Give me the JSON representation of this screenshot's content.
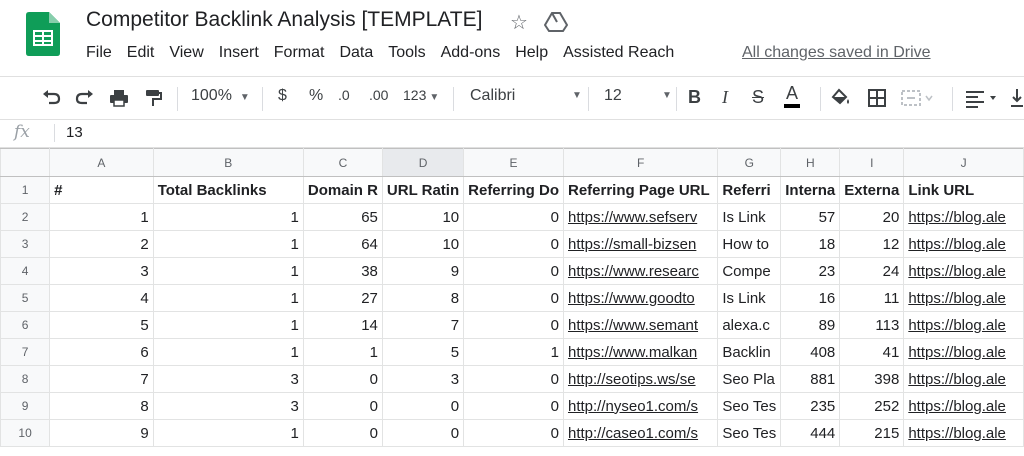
{
  "app": {
    "title": "Competitor Backlink Analysis [TEMPLATE]",
    "saved_status": "All changes saved in Drive",
    "menu": [
      "File",
      "Edit",
      "View",
      "Insert",
      "Format",
      "Data",
      "Tools",
      "Add-ons",
      "Help",
      "Assisted Reach"
    ]
  },
  "toolbar": {
    "zoom": "100%",
    "currency": "$",
    "percent": "%",
    "decrease_decimals": ".0",
    "increase_decimals": ".00",
    "more_formats": "123",
    "font": "Calibri",
    "font_size": "12",
    "bold": "B",
    "italic": "I",
    "strikethrough": "S",
    "text_color": "A"
  },
  "formula_bar": {
    "fx": "fx",
    "value": "13"
  },
  "grid": {
    "columns": [
      "A",
      "B",
      "C",
      "D",
      "E",
      "F",
      "G",
      "H",
      "I",
      "J"
    ],
    "header_row": [
      "#",
      "Total Backlinks",
      "Domain R",
      "URL Ratin",
      "Referring Do",
      "Referring Page URL",
      "Referri",
      "Interna",
      "Externa",
      "Link URL"
    ],
    "rows": [
      [
        "1",
        "1",
        "65",
        "10",
        "0",
        "https://www.sefserv",
        "Is Link",
        "57",
        "20",
        "https://blog.ale"
      ],
      [
        "2",
        "1",
        "64",
        "10",
        "0",
        "https://small-bizsen",
        "How to",
        "18",
        "12",
        "https://blog.ale"
      ],
      [
        "3",
        "1",
        "38",
        "9",
        "0",
        "https://www.researc",
        "Compe",
        "23",
        "24",
        "https://blog.ale"
      ],
      [
        "4",
        "1",
        "27",
        "8",
        "0",
        "https://www.goodto",
        "Is Link",
        "16",
        "11",
        "https://blog.ale"
      ],
      [
        "5",
        "1",
        "14",
        "7",
        "0",
        "https://www.semant",
        "alexa.c",
        "89",
        "113",
        "https://blog.ale"
      ],
      [
        "6",
        "1",
        "1",
        "5",
        "1",
        "https://www.malkan",
        "Backlin",
        "408",
        "41",
        "https://blog.ale"
      ],
      [
        "7",
        "3",
        "0",
        "3",
        "0",
        "http://seotips.ws/se",
        "Seo Pla",
        "881",
        "398",
        "https://blog.ale"
      ],
      [
        "8",
        "3",
        "0",
        "0",
        "0",
        "http://nyseo1.com/s",
        "Seo Tes",
        "235",
        "252",
        "https://blog.ale"
      ],
      [
        "9",
        "1",
        "0",
        "0",
        "0",
        "http://caseo1.com/s",
        "Seo Tes",
        "444",
        "215",
        "https://blog.ale"
      ]
    ]
  },
  "colors": {
    "accent": "#188038",
    "grid_line": "#e2e3e3",
    "header_bg": "#f8f9fa"
  }
}
